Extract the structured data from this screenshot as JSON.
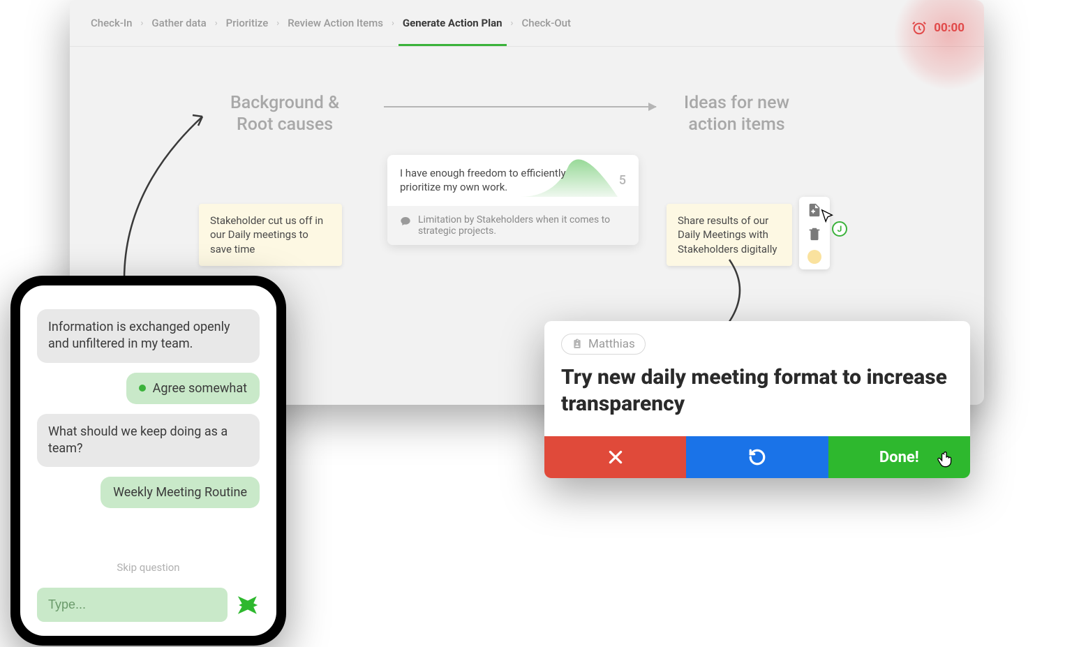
{
  "breadcrumb": {
    "items": [
      {
        "label": "Check-In",
        "active": false
      },
      {
        "label": "Gather data",
        "active": false
      },
      {
        "label": "Prioritize",
        "active": false
      },
      {
        "label": "Review Action Items",
        "active": false
      },
      {
        "label": "Generate Action Plan",
        "active": true
      },
      {
        "label": "Check-Out",
        "active": false
      }
    ]
  },
  "timer": {
    "value": "00:00"
  },
  "headings": {
    "left": "Background &\nRoot causes",
    "right": "Ideas for new\naction items"
  },
  "sticky_left": "Stakeholder cut us off in our Daily meetings to save time",
  "sticky_right": "Share results of our Daily Meetings with Stakeholders digitally",
  "center_card": {
    "top": "I have enough freedom to efficiently prioritize my own work.",
    "score": "5",
    "comment": "Limitation by Stakeholders when it comes to strategic projects."
  },
  "cursor_badge": "J",
  "phone": {
    "q1": "Information is exchanged openly and unfiltered in my team.",
    "a1": "Agree somewhat",
    "q2": "What should we keep doing as a team?",
    "a2": "Weekly Meeting Routine",
    "skip": "Skip question",
    "input_placeholder": "Type..."
  },
  "dialog": {
    "assignee": "Matthias",
    "title": "Try new daily meeting format to increase transparency",
    "done_label": "Done!"
  },
  "colors": {
    "green": "#3bb23b",
    "red": "#e04a3a",
    "blue": "#1a73e8",
    "sticky": "#fdf8e3"
  }
}
